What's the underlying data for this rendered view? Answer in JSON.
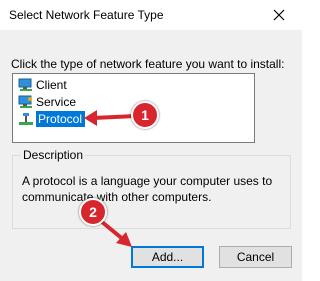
{
  "window": {
    "title": "Select Network Feature Type",
    "close_icon": "close-icon"
  },
  "instruction": "Click the type of network feature you want to install:",
  "features": [
    {
      "label": "Client",
      "icon": "client-network-icon",
      "selected": false
    },
    {
      "label": "Service",
      "icon": "service-network-icon",
      "selected": false
    },
    {
      "label": "Protocol",
      "icon": "protocol-network-icon",
      "selected": true
    }
  ],
  "description": {
    "title": "Description",
    "text": "A protocol is a language your computer uses to communicate with other computers."
  },
  "buttons": {
    "add": "Add...",
    "cancel": "Cancel"
  },
  "annotations": {
    "marker1": "1",
    "marker2": "2",
    "color": "#d7262e"
  },
  "colors": {
    "selection": "#0078d7",
    "dialog_bg": "#f0f0f0"
  }
}
